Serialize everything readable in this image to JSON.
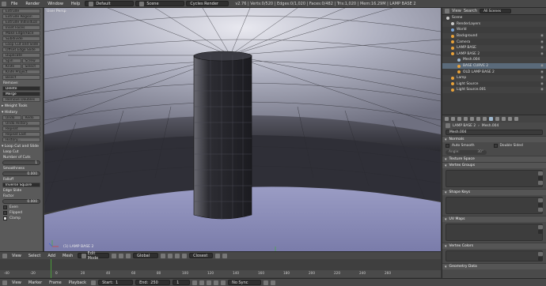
{
  "topbar": {
    "menus": [
      "File",
      "Render",
      "Window",
      "Help"
    ],
    "layout": "Default",
    "scene": "Scene",
    "engine": "Cycles Render",
    "stats": "v2.76 | Verts:0/520 | Edges:0/1,020 | Faces:0/482 | Tris:1,020 | Mem:16.29M | LAMP BASE 2"
  },
  "toolshelf": {
    "top_buttons": [
      "Extrude",
      "Extrude Region",
      "Extrude Individual",
      "Inset Faces",
      "Make Edge/Face",
      "Subdivide",
      "Loop Cut and Slide",
      "Offset Edge Slide",
      "Duplicate"
    ],
    "row1": [
      "Spin",
      "Screw"
    ],
    "row2": [
      "Knife",
      "Select"
    ],
    "mid_buttons": [
      "Knife Project",
      "Bisect"
    ],
    "remove_label": "Remove:",
    "dark_buttons": [
      "Delete",
      "Merge"
    ],
    "remove_doubles": "Remove Doubles",
    "weight_tools": "Weight Tools",
    "history_section": "History",
    "history_row": [
      "Undo",
      "Redo"
    ],
    "undo_history": "Undo History",
    "repeat_buttons": [
      "Repeat",
      "Repeat Last",
      "History..."
    ],
    "operator_section": "Loop Cut and Slide",
    "op_title": "Loop Cut",
    "cuts_label": "Number of Cuts",
    "cuts_value": "1",
    "smooth_label": "Smoothness",
    "smooth_value": "0.000",
    "falloff_label": "Falloff",
    "falloff_value": "Inverse Square",
    "edge_slide": "Edge Slide",
    "factor_label": "Factor",
    "factor_value": "0.000",
    "checks": [
      "Even",
      "Flipped",
      "Clamp"
    ]
  },
  "viewport": {
    "view_label": "User Persp",
    "object_label": "(1) LAMP BASE 2"
  },
  "vp_header": {
    "menus": [
      "View",
      "Select",
      "Add",
      "Mesh"
    ],
    "mode": "Edit Mode",
    "pivot": "Global",
    "snap": "Closest"
  },
  "timeline": {
    "ticks": [
      "-40",
      "-20",
      "0",
      "20",
      "40",
      "60",
      "80",
      "100",
      "120",
      "140",
      "160",
      "180",
      "200",
      "220",
      "240",
      "260"
    ],
    "menus": [
      "View",
      "Marker",
      "Frame",
      "Playback"
    ],
    "start": "Start:",
    "start_val": "1",
    "end": "End:",
    "end_val": "250",
    "current": "1",
    "sync": "No Sync"
  },
  "outliner": {
    "menus": [
      "View",
      "Search"
    ],
    "filter": "All Scenes",
    "items": [
      {
        "label": "Scene",
        "indent": 0
      },
      {
        "label": "RenderLayers",
        "indent": 1
      },
      {
        "label": "World",
        "indent": 1
      },
      {
        "label": "Background",
        "indent": 1
      },
      {
        "label": "Camera",
        "indent": 1
      },
      {
        "label": "LAMP BASE",
        "indent": 1
      },
      {
        "label": "LAMP BASE 2",
        "indent": 1
      },
      {
        "label": "Mesh.004",
        "indent": 2
      },
      {
        "label": "BASE CURVE 2",
        "indent": 2
      },
      {
        "label": "OLD LAMP BASE 2",
        "indent": 2
      },
      {
        "label": "Lamp",
        "indent": 1
      },
      {
        "label": "Light Source",
        "indent": 1
      },
      {
        "label": "Light Source.001",
        "indent": 1
      }
    ]
  },
  "props": {
    "object": "LAMP BASE 2",
    "mesh": "Mesh.004",
    "normals": "Normals",
    "auto_smooth": "Auto Smooth",
    "double_sided": "Double Sided",
    "angle": "Angle:",
    "angle_val": "30°",
    "texture_space": "Texture Space",
    "vertex_groups": "Vertex Groups",
    "shape_keys": "Shape Keys",
    "uv_maps": "UV Maps",
    "vertex_colors": "Vertex Colors",
    "geometry_data": "Geometry Data"
  }
}
